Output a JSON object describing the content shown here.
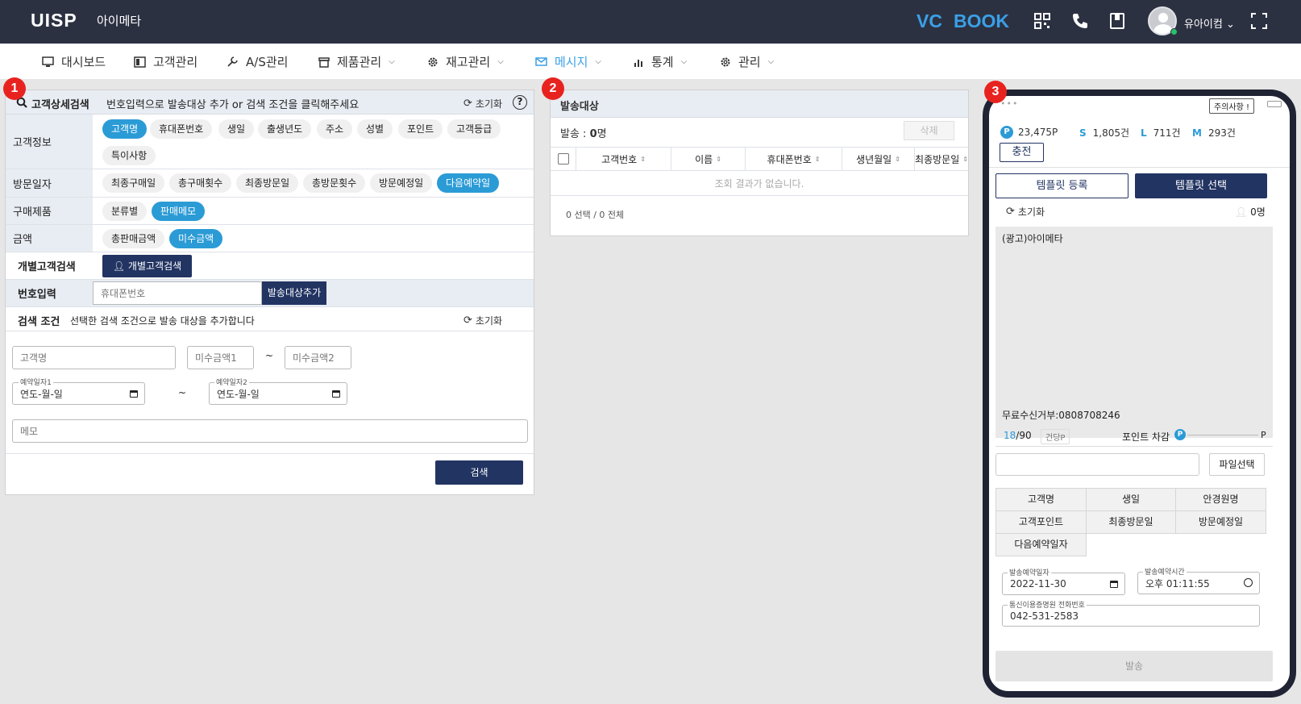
{
  "header": {
    "logo": "UISP",
    "company": "아이메타",
    "brand_vc": "VC",
    "brand_book": "BOOK",
    "user_name": "유아이컴 ⌄"
  },
  "nav": {
    "items": [
      {
        "label": "대시보드",
        "icon": "monitor-icon"
      },
      {
        "label": "고객관리",
        "icon": "contact-card-icon"
      },
      {
        "label": "A/S관리",
        "icon": "wrench-icon"
      },
      {
        "label": "제품관리",
        "icon": "box-icon"
      },
      {
        "label": "재고관리",
        "icon": "gear-icon"
      },
      {
        "label": "메시지",
        "icon": "envelope-icon"
      },
      {
        "label": "통계",
        "icon": "bar-chart-icon"
      },
      {
        "label": "관리",
        "icon": "gear-icon"
      }
    ],
    "active": "메시지",
    "accent": "#3aa0e6"
  },
  "badges": [
    "1",
    "2",
    "3"
  ],
  "panel1": {
    "title": "고객상세검색",
    "desc": "번호입력으로 발송대상 추가 or 검색 조건을 클릭해주세요",
    "reset": "초기화",
    "help": "?",
    "rows": {
      "customer_info": {
        "label": "고객정보",
        "chips": [
          "고객명",
          "휴대폰번호",
          "생일",
          "출생년도",
          "주소",
          "성별",
          "포인트",
          "고객등급",
          "특이사항"
        ]
      },
      "visit_date": {
        "label": "방문일자",
        "chips": [
          "최종구매일",
          "총구매횟수",
          "최종방문일",
          "총방문횟수",
          "방문예정일",
          "다음예약일"
        ]
      },
      "purchase": {
        "label": "구매제품",
        "chips": [
          "분류별",
          "판매메모"
        ]
      },
      "amount": {
        "label": "금액",
        "chips": [
          "총판매금액",
          "미수금액"
        ]
      },
      "individual": {
        "label": "개별고객검색",
        "button": "개별고객검색"
      },
      "number_input": {
        "label": "번호입력",
        "placeholder": "휴대폰번호",
        "button": "발송대상추가"
      }
    },
    "search_cond": {
      "label": "검색 조건",
      "desc": "선택한 검색 조건으로 발송 대상을 추가합니다",
      "reset": "초기화",
      "name_placeholder": "고객명",
      "amount1_placeholder": "미수금액1",
      "tilde": "~",
      "amount2_placeholder": "미수금액2",
      "date1_label": "예약일자1",
      "date1_value": "연도-월-일",
      "date2_label": "예약일자2",
      "date2_value": "연도-월-일",
      "memo_placeholder": "메모",
      "search_button": "검색"
    }
  },
  "panel2": {
    "title": "발송대상",
    "count_label": "발송 : ",
    "count_value": "0",
    "count_unit": "명",
    "delete_button": "삭제",
    "columns": [
      "고객번호",
      "이름",
      "휴대폰번호",
      "생년월일",
      "최종방문일"
    ],
    "empty_message": "조회 결과가 없습니다.",
    "selection_status": "0 선택 / 0 전체"
  },
  "phone": {
    "dots": "•••",
    "notice": "주의사항 !",
    "stats": {
      "p_icon": "P",
      "p_value": "23,475P",
      "s_letter": "S",
      "s_value": "1,805건",
      "l_letter": "L",
      "l_value": "711건",
      "m_letter": "M",
      "m_value": "293건"
    },
    "charge_button": "충전",
    "template_register": "템플릿 등록",
    "template_select": "템플릿 선택",
    "reset": "초기화",
    "recipients": "0명",
    "message_top": "(광고)아이메타",
    "message_bottom": "무료수신거부:0808708246",
    "char_count": "18",
    "char_max": "/90",
    "per_unit": "건당P",
    "point_deduct": "포인트 차감",
    "point_suffix": "P",
    "file_button": "파일선택",
    "variables": [
      "고객명",
      "생일",
      "안경원명",
      "고객포인트",
      "최종방문일",
      "방문예정일",
      "다음예약일자"
    ],
    "send_date_label": "발송예약일자",
    "send_date_value": "2022-11-30",
    "send_time_label": "발송예약시간",
    "send_time_value": "오후 01:11:55",
    "phone_label": "통신이용증명원 전화번호",
    "phone_value": "042-531-2583",
    "send_button": "발송"
  }
}
